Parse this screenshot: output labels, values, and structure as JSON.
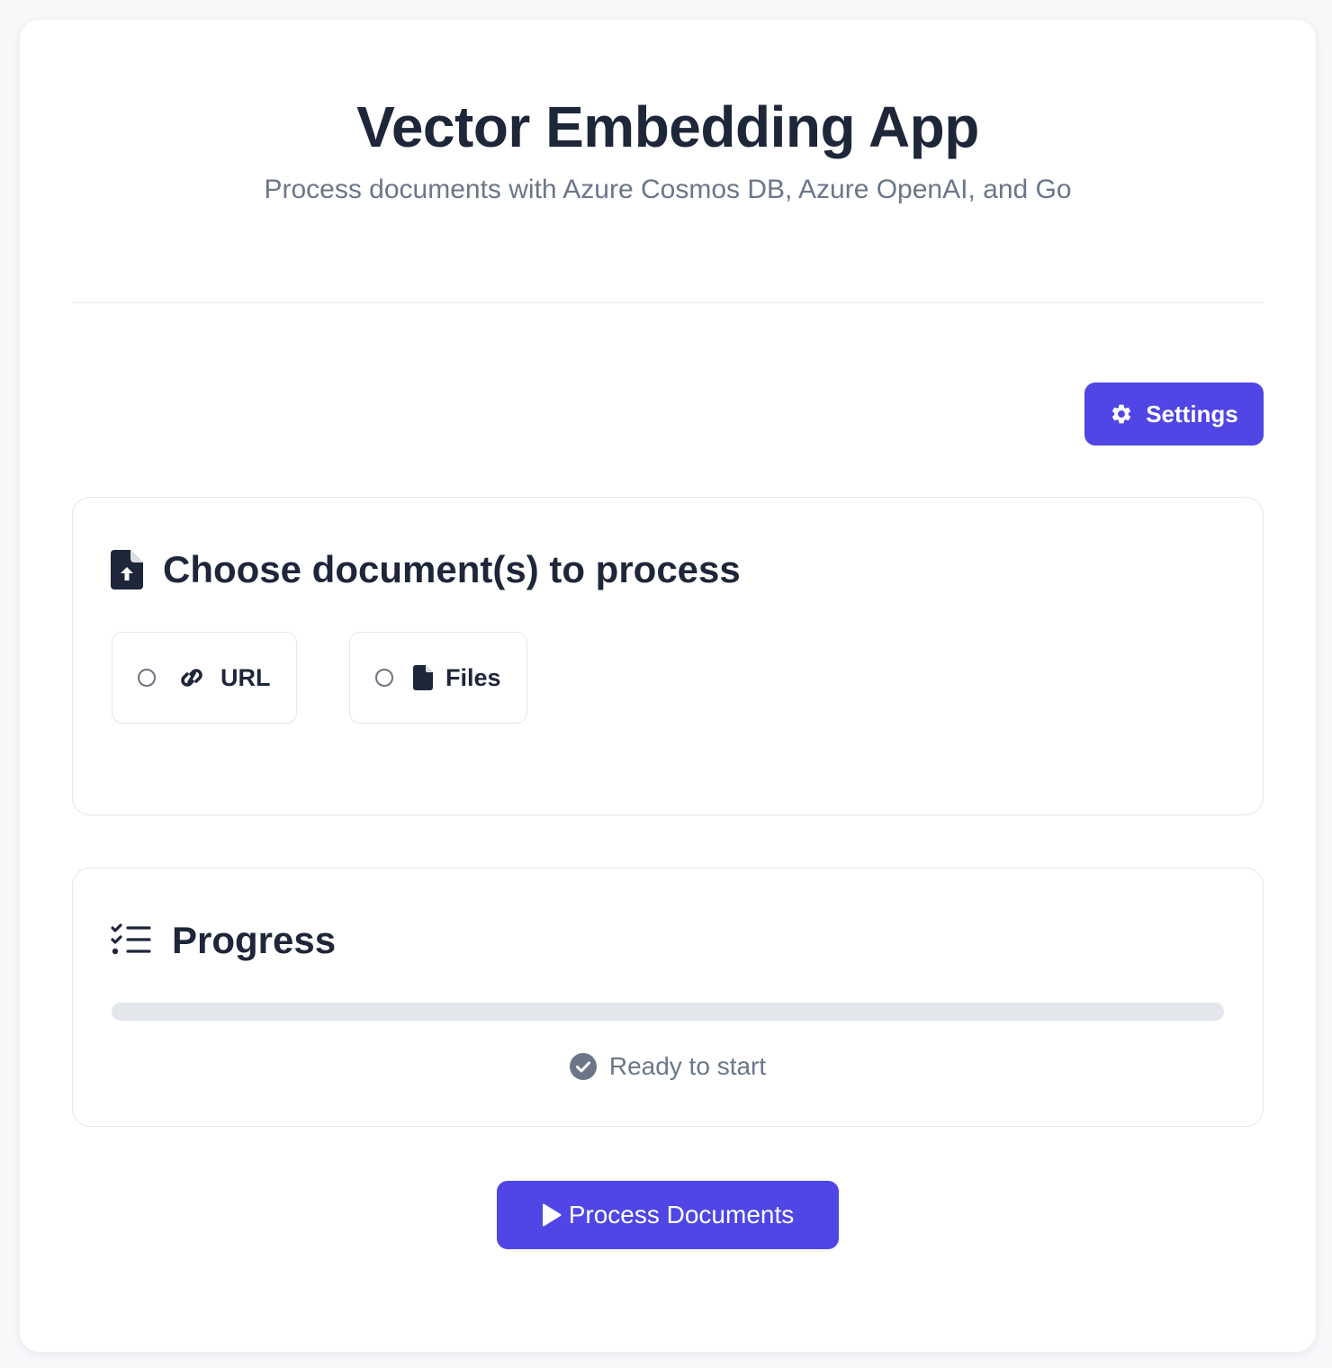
{
  "header": {
    "title": "Vector Embedding App",
    "subtitle": "Process documents with Azure Cosmos DB, Azure OpenAI, and Go"
  },
  "toolbar": {
    "settings_label": "Settings",
    "settings_icon": "gear-icon"
  },
  "choose_panel": {
    "heading": "Choose document(s) to process",
    "heading_icon": "file-upload-icon",
    "options": [
      {
        "label": "URL",
        "icon": "link-icon",
        "selected": false
      },
      {
        "label": "Files",
        "icon": "file-icon",
        "selected": false
      }
    ]
  },
  "progress_panel": {
    "heading": "Progress",
    "heading_icon": "checklist-icon",
    "progress_percent": 0,
    "status_text": "Ready to start",
    "status_icon": "check-circle-icon"
  },
  "actions": {
    "process_label": "Process Documents",
    "process_icon": "play-icon"
  },
  "colors": {
    "accent": "#4f46e5",
    "text": "#1e2639",
    "muted": "#6b7689",
    "track": "#e3e7ec"
  }
}
